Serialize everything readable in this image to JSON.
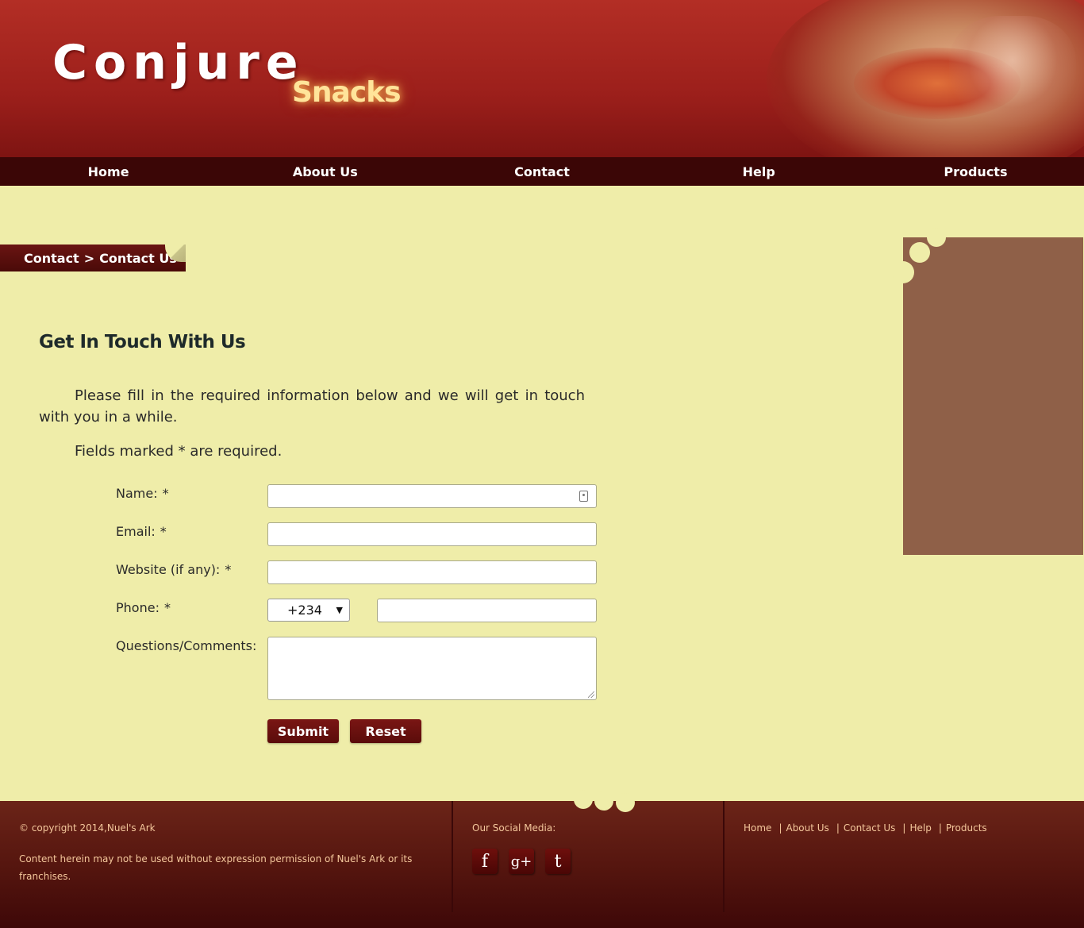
{
  "brand": {
    "name": "Conjure",
    "tagline": "Snacks"
  },
  "nav": {
    "items": [
      "Home",
      "About Us",
      "Contact",
      "Help",
      "Products"
    ]
  },
  "breadcrumb": {
    "parent": "Contact",
    "separator": ">",
    "current": "Contact Us"
  },
  "main": {
    "title": "Get In Touch With Us",
    "intro": "Please fill in the required information below and we will get in touch with you in a while.",
    "required_note": "Fields marked * are required."
  },
  "form": {
    "name_label": "Name:",
    "email_label": "Email:",
    "website_label": "Website (if any):",
    "phone_label": "Phone:",
    "comments_label": "Questions/Comments:",
    "required_mark": "*",
    "country_code": "+234",
    "submit_label": "Submit",
    "reset_label": "Reset"
  },
  "footer": {
    "copyright": "© copyright 2014,Nuel's Ark",
    "disclaimer": "Content herein may not be used without expression permission of Nuel's Ark or its franchises.",
    "social_title": "Our Social Media:",
    "social": [
      {
        "glyph": "f",
        "icon": "facebook-icon"
      },
      {
        "glyph": "g+",
        "icon": "google-plus-icon"
      },
      {
        "glyph": "t",
        "icon": "tumblr-icon"
      }
    ],
    "links": [
      "Home",
      "About Us",
      "Contact Us",
      "Help",
      "Products"
    ],
    "link_separator": "|"
  },
  "colors": {
    "page_bg": "#efeda9",
    "header_red": "#9c1f1b",
    "nav_bg": "#3b0606",
    "side_panel": "#8f6048",
    "button": "#6a1210",
    "footer_text": "#f4c79b"
  }
}
